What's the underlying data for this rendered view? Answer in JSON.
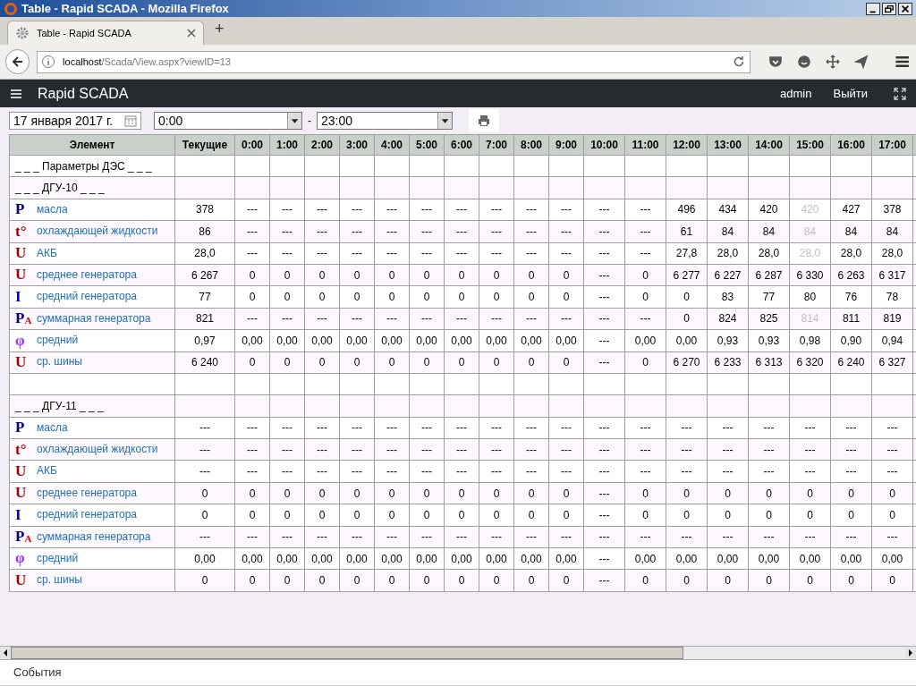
{
  "window": {
    "title": "Table - Rapid SCADA - Mozilla Firefox"
  },
  "browser": {
    "tab_title": "Table - Rapid SCADA",
    "url_host": "localhost",
    "url_path": "/Scada/View.aspx?viewID=13",
    "new_tab": "+"
  },
  "app": {
    "title": "Rapid SCADA",
    "user": "admin",
    "logout": "Выйти"
  },
  "toolbar": {
    "date": "17 января 2017 г.",
    "time_from": "0:00",
    "separator": "-",
    "time_to": "23:00"
  },
  "table": {
    "columns": [
      "Элемент",
      "Текущие",
      "0:00",
      "1:00",
      "2:00",
      "3:00",
      "4:00",
      "5:00",
      "6:00",
      "7:00",
      "8:00",
      "9:00",
      "10:00",
      "11:00",
      "12:00",
      "13:00",
      "14:00",
      "15:00",
      "16:00",
      "17:00"
    ],
    "rows": [
      {
        "kind": "group",
        "label": "_ _ _ Параметры ДЭС _ _ _"
      },
      {
        "kind": "group",
        "label": "_ _ _ ДГУ-10 _ _ _"
      },
      {
        "kind": "data",
        "symbol": "P",
        "color": "#00007f",
        "label": "масла",
        "current": "378",
        "values": [
          "---",
          "---",
          "---",
          "---",
          "---",
          "---",
          "---",
          "---",
          "---",
          "---",
          "---",
          "---",
          "496",
          "434",
          "420",
          {
            "text": "420",
            "dimmed": true
          },
          "427",
          "378"
        ]
      },
      {
        "kind": "data",
        "symbol": "t°",
        "color": "#a00000",
        "label": "охлаждающей жидкости",
        "current": "86",
        "values": [
          "---",
          "---",
          "---",
          "---",
          "---",
          "---",
          "---",
          "---",
          "---",
          "---",
          "---",
          "---",
          "61",
          "84",
          "84",
          {
            "text": "84",
            "dimmed": true
          },
          "84",
          "84"
        ]
      },
      {
        "kind": "data",
        "symbol": "U",
        "color": "#a00000",
        "label": "АКБ",
        "current": "28,0",
        "values": [
          "---",
          "---",
          "---",
          "---",
          "---",
          "---",
          "---",
          "---",
          "---",
          "---",
          "---",
          "---",
          "27,8",
          "28,0",
          "28,0",
          {
            "text": "28,0",
            "dimmed": true
          },
          "28,0",
          "28,0"
        ]
      },
      {
        "kind": "data",
        "symbol": "U",
        "color": "#a00000",
        "label": "среднее генератора",
        "current": "6 267",
        "values": [
          "0",
          "0",
          "0",
          "0",
          "0",
          "0",
          "0",
          "0",
          "0",
          "0",
          "---",
          "0",
          "6 277",
          "6 227",
          "6 287",
          "6 330",
          "6 263",
          "6 317"
        ]
      },
      {
        "kind": "data",
        "symbol": "I",
        "color": "#0000cc",
        "label": "средний генератора",
        "current": "77",
        "values": [
          "0",
          "0",
          "0",
          "0",
          "0",
          "0",
          "0",
          "0",
          "0",
          "0",
          "---",
          "0",
          "0",
          "83",
          "77",
          "80",
          "76",
          "78"
        ]
      },
      {
        "kind": "data",
        "symbol": "P",
        "sub": {
          "text": "A",
          "color": "#cc0000"
        },
        "color": "#00007f",
        "label": "суммарная генератора",
        "current": "821",
        "values": [
          "---",
          "---",
          "---",
          "---",
          "---",
          "---",
          "---",
          "---",
          "---",
          "---",
          "---",
          "---",
          "0",
          "824",
          "825",
          {
            "text": "814",
            "dimmed": true
          },
          "811",
          "819"
        ]
      },
      {
        "kind": "data",
        "symbol": "φ",
        "color": "#9933ff",
        "label": "средний",
        "current": "0,97",
        "values": [
          "0,00",
          "0,00",
          "0,00",
          "0,00",
          "0,00",
          "0,00",
          "0,00",
          "0,00",
          "0,00",
          "0,00",
          "---",
          "0,00",
          "0,00",
          "0,93",
          "0,93",
          "0,98",
          "0,90",
          "0,94"
        ]
      },
      {
        "kind": "data",
        "symbol": "U",
        "color": "#a00000",
        "label": "ср. шины",
        "current": "6 240",
        "values": [
          "0",
          "0",
          "0",
          "0",
          "0",
          "0",
          "0",
          "0",
          "0",
          "0",
          "---",
          "0",
          "6 270",
          "6 233",
          "6 313",
          "6 320",
          "6 240",
          "6 327"
        ]
      },
      {
        "kind": "blank"
      },
      {
        "kind": "group",
        "label": "_ _ _ ДГУ-11 _ _ _"
      },
      {
        "kind": "data",
        "symbol": "P",
        "color": "#00007f",
        "label": "масла",
        "current": "---",
        "values": [
          "---",
          "---",
          "---",
          "---",
          "---",
          "---",
          "---",
          "---",
          "---",
          "---",
          "---",
          "---",
          "---",
          "---",
          "---",
          "---",
          "---",
          "---"
        ]
      },
      {
        "kind": "data",
        "symbol": "t°",
        "color": "#a00000",
        "label": "охлаждающей жидкости",
        "current": "---",
        "values": [
          "---",
          "---",
          "---",
          "---",
          "---",
          "---",
          "---",
          "---",
          "---",
          "---",
          "---",
          "---",
          "---",
          "---",
          "---",
          "---",
          "---",
          "---"
        ]
      },
      {
        "kind": "data",
        "symbol": "U",
        "color": "#a00000",
        "label": "АКБ",
        "current": "---",
        "values": [
          "---",
          "---",
          "---",
          "---",
          "---",
          "---",
          "---",
          "---",
          "---",
          "---",
          "---",
          "---",
          "---",
          "---",
          "---",
          "---",
          "---",
          "---"
        ]
      },
      {
        "kind": "data",
        "symbol": "U",
        "color": "#a00000",
        "label": "среднее генератора",
        "current": "0",
        "values": [
          "0",
          "0",
          "0",
          "0",
          "0",
          "0",
          "0",
          "0",
          "0",
          "0",
          "---",
          "0",
          "0",
          "0",
          "0",
          "0",
          "0",
          "0"
        ]
      },
      {
        "kind": "data",
        "symbol": "I",
        "color": "#0000cc",
        "label": "средний генератора",
        "current": "0",
        "values": [
          "0",
          "0",
          "0",
          "0",
          "0",
          "0",
          "0",
          "0",
          "0",
          "0",
          "---",
          "0",
          "0",
          "0",
          "0",
          "0",
          "0",
          "0"
        ]
      },
      {
        "kind": "data",
        "symbol": "P",
        "sub": {
          "text": "A",
          "color": "#cc0000"
        },
        "color": "#00007f",
        "label": "суммарная генератора",
        "current": "---",
        "values": [
          "---",
          "---",
          "---",
          "---",
          "---",
          "---",
          "---",
          "---",
          "---",
          "---",
          "---",
          "---",
          "---",
          "---",
          "---",
          "---",
          "---",
          "---"
        ]
      },
      {
        "kind": "data",
        "symbol": "φ",
        "color": "#9933ff",
        "label": "средний",
        "current": "0,00",
        "values": [
          "0,00",
          "0,00",
          "0,00",
          "0,00",
          "0,00",
          "0,00",
          "0,00",
          "0,00",
          "0,00",
          "0,00",
          "---",
          "0,00",
          "0,00",
          "0,00",
          "0,00",
          "0,00",
          "0,00",
          "0,00"
        ]
      },
      {
        "kind": "data",
        "symbol": "U",
        "color": "#a00000",
        "label": "ср. шины",
        "current": "0",
        "values": [
          "0",
          "0",
          "0",
          "0",
          "0",
          "0",
          "0",
          "0",
          "0",
          "0",
          "---",
          "0",
          "0",
          "0",
          "0",
          "0",
          "0",
          "0"
        ]
      }
    ]
  },
  "bottom_panel": {
    "title": "События"
  }
}
